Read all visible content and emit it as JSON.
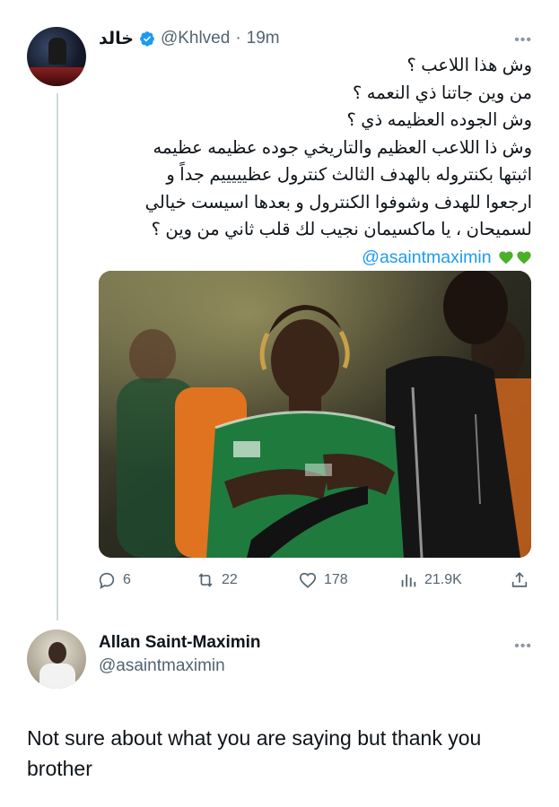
{
  "tweet": {
    "author_name": "خالد",
    "handle": "@Khlved",
    "separator": "·",
    "time": "19m",
    "lines": [
      "وش هذا اللاعب ؟",
      "من وين جاتنا ذي النعمه ؟",
      "وش الجوده العظيمه ذي ؟",
      "وش ذا اللاعب العظيم والتاريخي جوده عظيمه عظيمه",
      "اثبتها بكنتروله بالهدف الثالث كنترول عظيييييم جداً و",
      "ارجعوا للهدف وشوفوا الكنترول و بعدها اسيست خيالي",
      "لسميحان ، يا ماكسيمان نجيب لك قلب ثاني من وين ؟"
    ],
    "mention": "@asaintmaximin",
    "media_icon": "photo-football-player",
    "stats": {
      "replies": "6",
      "retweets": "22",
      "likes": "178",
      "views": "21.9K"
    }
  },
  "reply": {
    "author_name": "Allan Saint-Maximin",
    "handle": "@asaintmaximin",
    "text": "Not sure about what you are saying but thank you brother"
  },
  "colors": {
    "accent": "#1d9bf0",
    "secondary_text": "#536471",
    "heart_green": "#4caf2a",
    "jersey_green": "#1f7a3e"
  }
}
